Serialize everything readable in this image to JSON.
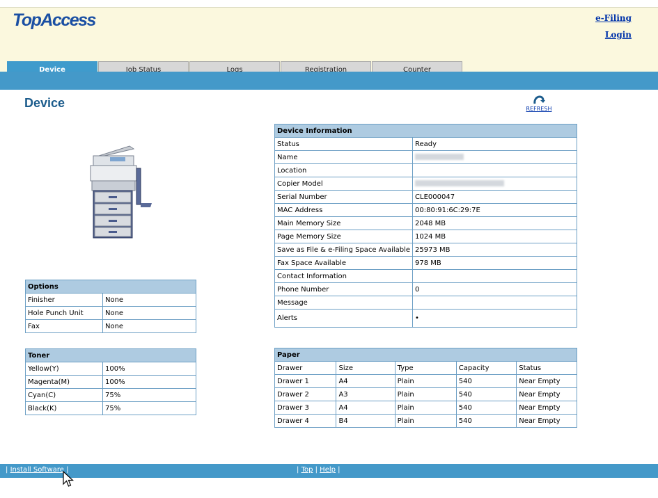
{
  "header": {
    "logo": "TopAccess",
    "efiling_link": "e-Filing",
    "login_link": "Login"
  },
  "tabs": [
    {
      "label": "Device",
      "active": true
    },
    {
      "label": "Job Status"
    },
    {
      "label": "Logs"
    },
    {
      "label": "Registration"
    },
    {
      "label": "Counter"
    }
  ],
  "page": {
    "title": "Device",
    "refresh_label": "REFRESH"
  },
  "device_info": {
    "caption": "Device Information",
    "rows": [
      {
        "label": "Status",
        "value": "Ready"
      },
      {
        "label": "Name",
        "value": "",
        "redacted": true
      },
      {
        "label": "Location",
        "value": ""
      },
      {
        "label": "Copier Model",
        "value": "",
        "redacted": true
      },
      {
        "label": "Serial Number",
        "value": "CLE000047"
      },
      {
        "label": "MAC Address",
        "value": "00:80:91:6C:29:7E"
      },
      {
        "label": "Main Memory Size",
        "value": "2048 MB"
      },
      {
        "label": "Page Memory Size",
        "value": "1024 MB"
      },
      {
        "label": "Save as File & e-Filing Space Available",
        "value": "25973 MB"
      },
      {
        "label": "Fax Space Available",
        "value": "978 MB"
      },
      {
        "label": "Contact Information",
        "value": ""
      },
      {
        "label": "Phone Number",
        "value": "0"
      },
      {
        "label": "Message",
        "value": ""
      },
      {
        "label": "Alerts",
        "value": "•"
      }
    ]
  },
  "options": {
    "caption": "Options",
    "rows": [
      {
        "label": "Finisher",
        "value": "None"
      },
      {
        "label": "Hole Punch Unit",
        "value": "None"
      },
      {
        "label": "Fax",
        "value": "None"
      }
    ]
  },
  "toner": {
    "caption": "Toner",
    "rows": [
      {
        "label": "Yellow(Y)",
        "value": "100%"
      },
      {
        "label": "Magenta(M)",
        "value": "100%"
      },
      {
        "label": "Cyan(C)",
        "value": "75%"
      },
      {
        "label": "Black(K)",
        "value": "75%"
      }
    ]
  },
  "paper": {
    "caption": "Paper",
    "columns": [
      "Drawer",
      "Size",
      "Type",
      "Capacity",
      "Status"
    ],
    "rows": [
      [
        "Drawer 1",
        "A4",
        "Plain",
        "540",
        "Near Empty"
      ],
      [
        "Drawer 2",
        "A3",
        "Plain",
        "540",
        "Near Empty"
      ],
      [
        "Drawer 3",
        "A4",
        "Plain",
        "540",
        "Near Empty"
      ],
      [
        "Drawer 4",
        "B4",
        "Plain",
        "540",
        "Near Empty"
      ]
    ]
  },
  "footer": {
    "install_software": "Install Software",
    "top": "Top",
    "help": "Help"
  },
  "colors": {
    "accent": "#4499c9",
    "header_bg": "#fbf8de",
    "table_caption_bg": "#aecbe1",
    "link": "#0033aa"
  }
}
